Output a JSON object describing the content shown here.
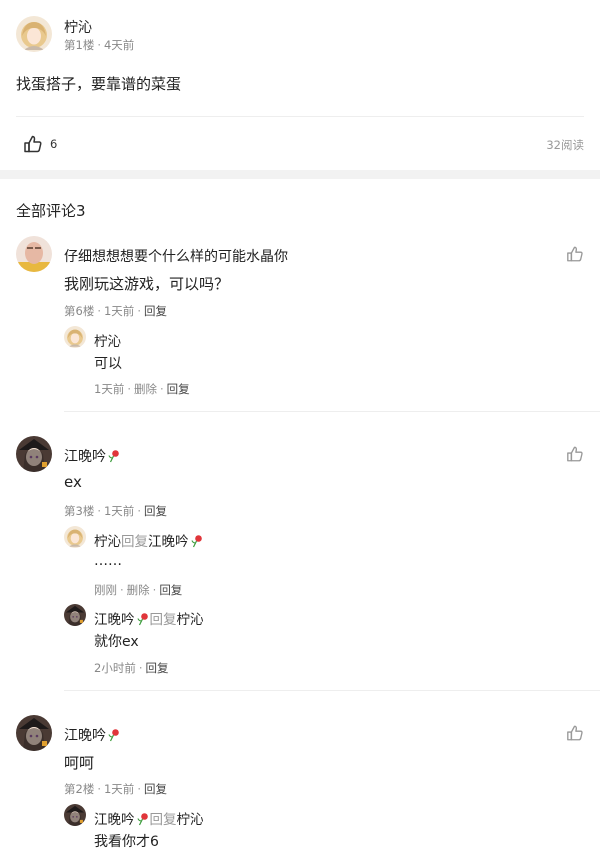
{
  "post": {
    "author": "柠沁",
    "floor": "第1楼",
    "dot": "·",
    "time": "4天前",
    "content": "找蛋搭子，要靠谱的菜蛋",
    "like_count": "6",
    "read_count": "32阅读"
  },
  "comments_header": "全部评论3",
  "labels": {
    "reply": "回复",
    "delete": "删除",
    "reply_to": "回复",
    "dot": "·"
  },
  "comments": [
    {
      "author": "仔细想想想要个什么样的可能水晶你",
      "text": "我刚玩这游戏，可以吗？",
      "floor": "第6楼",
      "time": "1天前",
      "replies": [
        {
          "author": "柠沁",
          "text": "可以",
          "time": "1天前"
        }
      ]
    },
    {
      "author": "江晚吟",
      "text": "ex",
      "floor": "第3楼",
      "time": "1天前",
      "replies": [
        {
          "author": "柠沁",
          "target": "江晚吟",
          "text": "……",
          "time": "刚刚"
        },
        {
          "author": "江晚吟",
          "target": "柠沁",
          "text": "就你ex",
          "time": "2小时前"
        }
      ]
    },
    {
      "author": "江晚吟",
      "text": "呵呵",
      "floor": "第2楼",
      "time": "1天前",
      "replies": [
        {
          "author": "江晚吟",
          "target": "柠沁",
          "text": "我看你才6"
        }
      ]
    }
  ],
  "icons": {
    "like": "thumbs-up-icon",
    "flower": "rose-emoji-icon"
  },
  "colors": {
    "background": "#ffffff",
    "section_gap": "#f2f2f2",
    "text": "#222222",
    "meta": "#888888",
    "divider": "#eeeeee"
  }
}
